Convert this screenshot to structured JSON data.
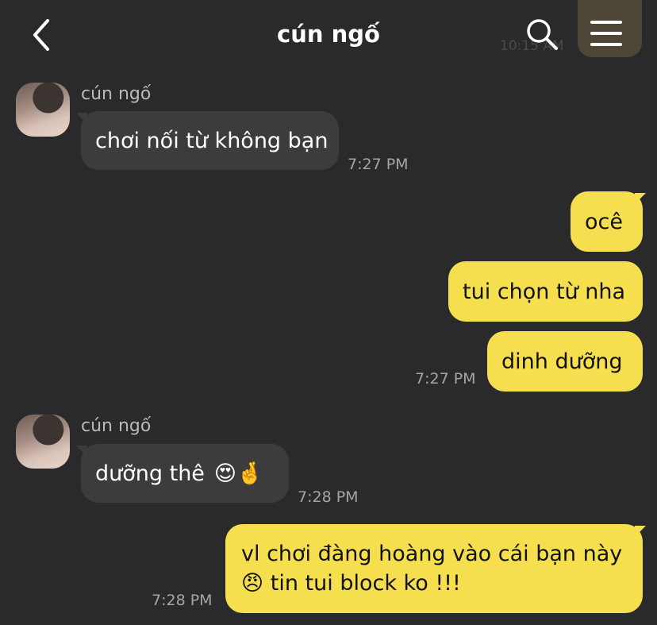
{
  "header": {
    "title": "cún ngố",
    "ghost_time": "10:15 AM"
  },
  "icons": {
    "back": "chevron-left-icon",
    "search": "search-icon",
    "menu": "hamburger-menu-icon"
  },
  "colors": {
    "background": "#2a2a2c",
    "incoming_bubble": "#3c3c3e",
    "outgoing_bubble": "#f6df4f",
    "timestamp": "#a5a5a5"
  },
  "messages": [
    {
      "sender": "cún ngố",
      "text": "chơi nối từ không bạn",
      "time": "7:27 PM"
    },
    {
      "text": "ocê"
    },
    {
      "text": "tui chọn từ nha"
    },
    {
      "text": "dinh dưỡng",
      "time": "7:27 PM"
    },
    {
      "sender": "cún ngố",
      "text": "dưỡng thê",
      "emojis": "😍🤞",
      "time": "7:28 PM"
    },
    {
      "line1": "vl chơi đàng hoàng vào cái bạn này",
      "emoji": "😠",
      "line2": "tin tui block ko !!!",
      "time": "7:28 PM"
    }
  ]
}
